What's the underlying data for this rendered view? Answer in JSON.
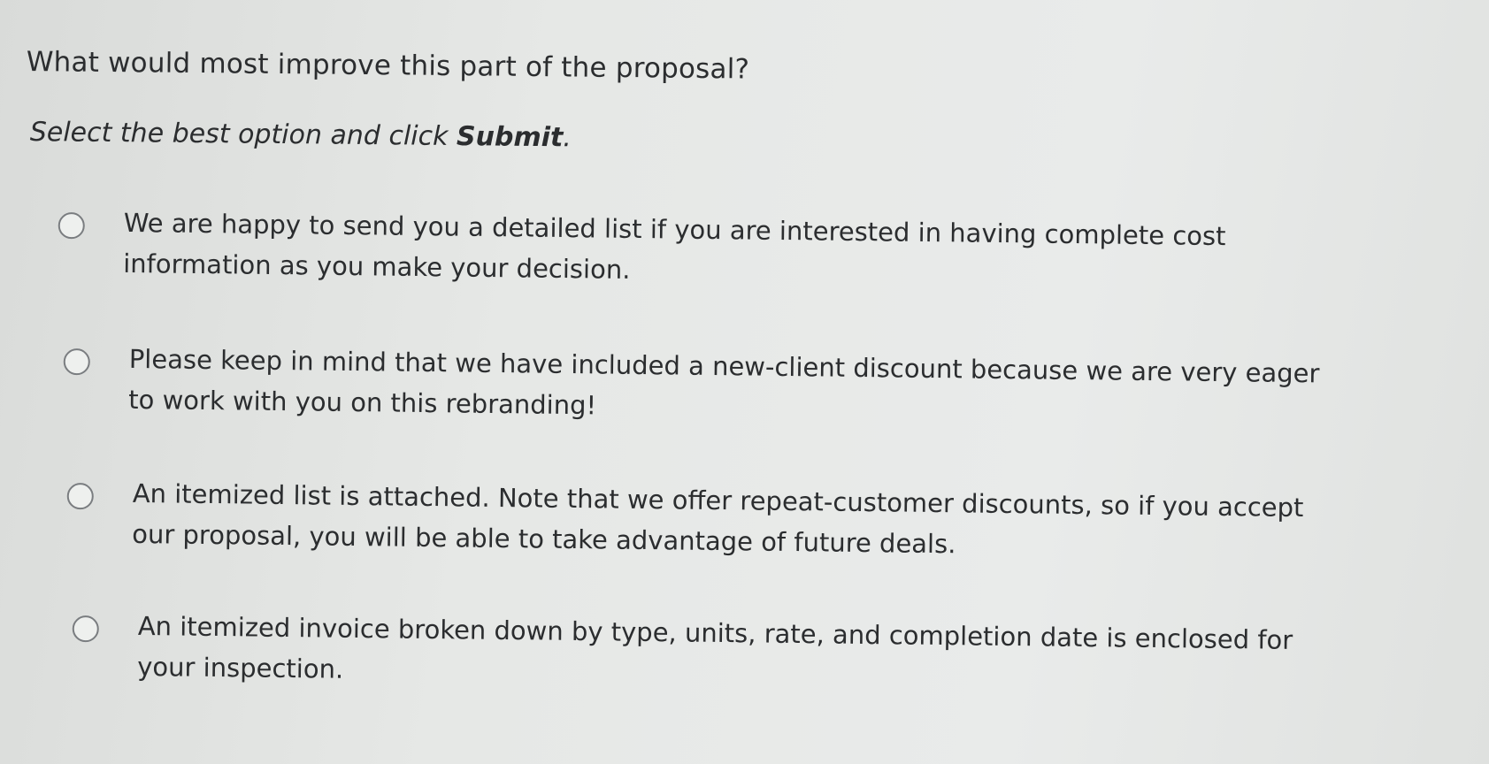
{
  "question": "What would most improve this part of the proposal?",
  "instruction": {
    "prefix": "Select the best option and click ",
    "emphasis": "Submit",
    "suffix": "."
  },
  "options": [
    {
      "text": "We are happy to send you a detailed list if you are interested in having complete cost information as you make your decision."
    },
    {
      "text": "Please keep in mind that we have included a new-client discount because we are very eager to work with you on this rebranding!"
    },
    {
      "text": "An itemized list is attached. Note that we offer repeat-customer discounts, so if you accept our proposal, you will be able to take advantage of future deals."
    },
    {
      "text": "An itemized invoice broken down by type, units, rate, and completion date is enclosed for your inspection."
    }
  ],
  "colors": {
    "background": "#e4e6e4",
    "text": "#2b2d2f",
    "radio_border": "#7a7d80"
  }
}
